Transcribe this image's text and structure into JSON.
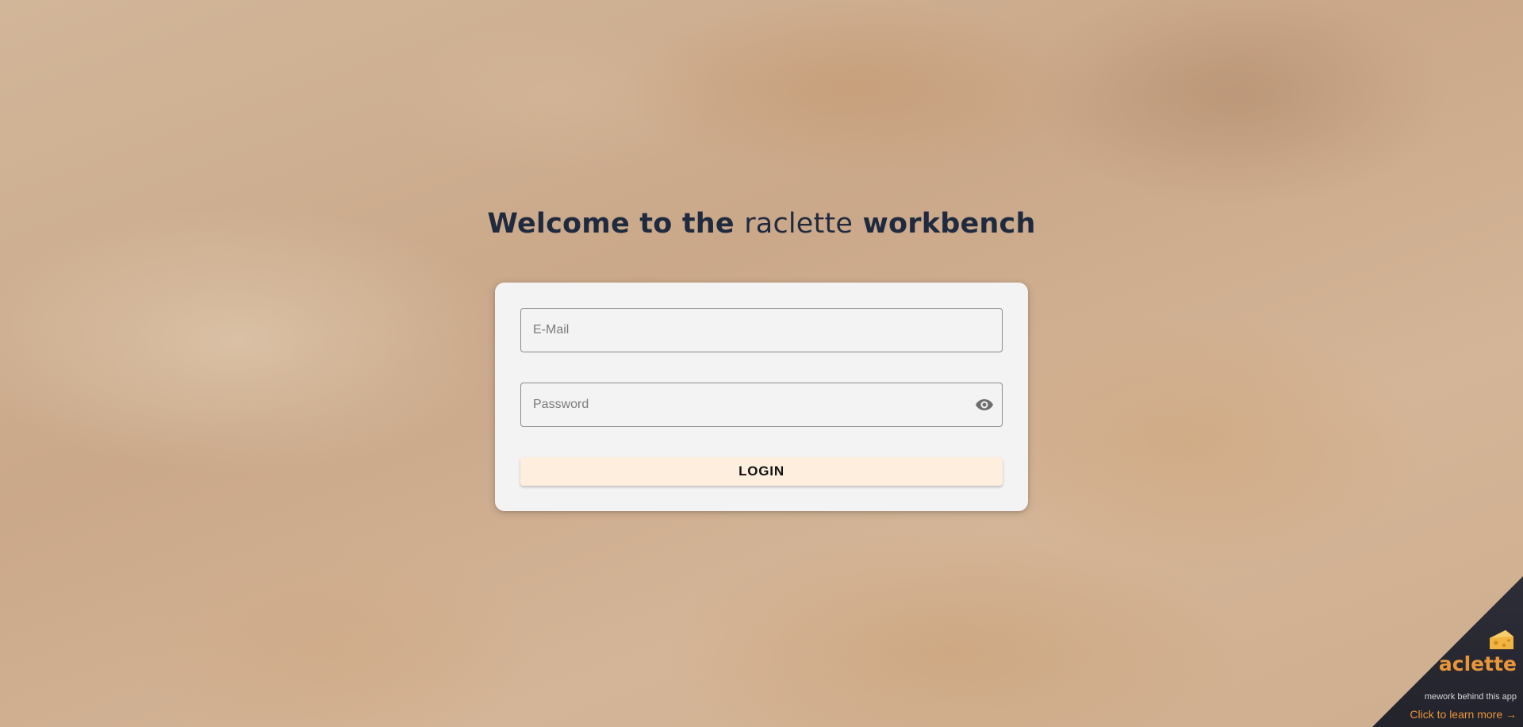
{
  "header": {
    "title_prefix": "Welcome to the ",
    "title_brand": "raclette",
    "title_suffix": " workbench"
  },
  "login_form": {
    "email_placeholder": "E-Mail",
    "password_placeholder": "Password",
    "toggle_visibility_icon": "eye-icon",
    "login_label": "LOGIN"
  },
  "corner_promo": {
    "logo_icon": "cheese-icon",
    "brand_visible": "aclette",
    "tagline_visible": "mework behind this app",
    "cta": "Click to learn more →"
  },
  "colors": {
    "title": "#1f2a3f",
    "card": "#f4f3f4",
    "login_button": "#fdeede",
    "promo_background": "#23232c",
    "promo_accent": "#e9953a"
  }
}
